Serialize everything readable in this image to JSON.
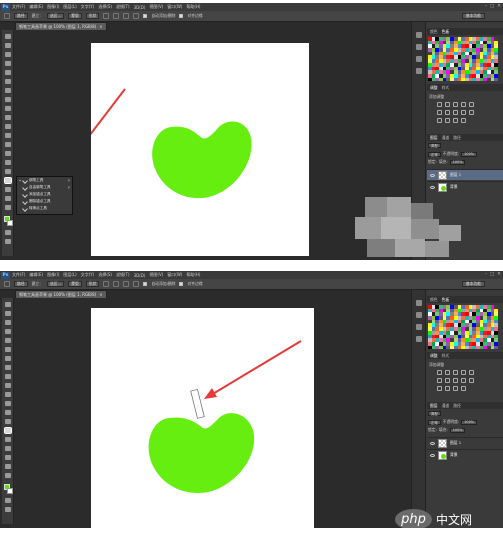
{
  "menubar": {
    "logo": "Ps",
    "items": [
      "文件(F)",
      "编辑(E)",
      "图像(I)",
      "图层(L)",
      "文字(Y)",
      "选择(S)",
      "滤镜(T)",
      "3D(D)",
      "视图(V)",
      "窗口(W)",
      "帮助(H)"
    ]
  },
  "options_top": {
    "mode": "路径",
    "make_label": "建立：",
    "selection_btn": "选区...",
    "mask_btn": "蒙版",
    "shape_btn": "形状",
    "auto_add_delete": "自动添加/删除",
    "align_edges": "对齐边缘",
    "workspace": "基本功能"
  },
  "options_bottom": {
    "mode": "路径",
    "make_label": "建立：",
    "selection_btn": "选区...",
    "mask_btn": "蒙版",
    "shape_btn": "形状",
    "auto_add_delete": "自动添加/删除",
    "align_edges": "对齐边缘",
    "workspace": "基本功能"
  },
  "doc_tab_top": "钢笔工具画苹果 @ 100% (图层 1, RGB/8)",
  "doc_tab_bottom": "钢笔工具画苹果 @ 100% (图层 1, RGB/8)",
  "flyout": {
    "items": [
      {
        "label": "钢笔工具",
        "key": "P",
        "active": true
      },
      {
        "label": "自由钢笔工具",
        "key": "P",
        "active": false
      },
      {
        "label": "添加锚点工具",
        "key": "",
        "active": false
      },
      {
        "label": "删除锚点工具",
        "key": "",
        "active": false
      },
      {
        "label": "转换点工具",
        "key": "",
        "active": false
      }
    ]
  },
  "panels": {
    "tabs_color": [
      "颜色",
      "色板"
    ],
    "tabs_adjust": [
      "调整",
      "样式"
    ],
    "adjust_title": "添加调整",
    "tabs_layers": [
      "图层",
      "通道",
      "路径"
    ],
    "kind_filter": "类型",
    "blend_mode": "正常",
    "opacity_label": "不透明度:",
    "opacity_value": "100%",
    "lock_label": "锁定:",
    "fill_label": "填充:",
    "fill_value": "100%",
    "layers": [
      "图层 1",
      "背景"
    ]
  },
  "colors": {
    "apple_green": "#66ee11",
    "arrow_red": "#e53a3a",
    "chrome": "#2b2b2b",
    "selected_layer": "#5a6b85"
  },
  "watermark": {
    "badge": "php",
    "text": "中文网"
  }
}
